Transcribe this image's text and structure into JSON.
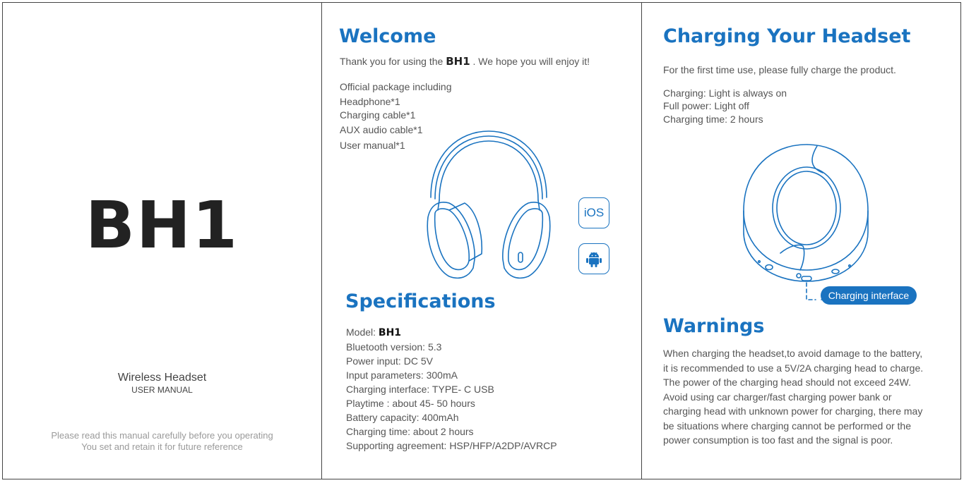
{
  "cover": {
    "title": "BH1",
    "product_name": "Wireless Headset",
    "manual_label": "USER MANUAL",
    "note_lines": [
      "Please read this manual carefully before you operating",
      "You set and retain it for future reference"
    ]
  },
  "welcome": {
    "heading": "Welcome",
    "thanks_before": "Thank you for using the ",
    "thanks_model": "BH1",
    "thanks_after": " . We hope you will enjoy it!",
    "package_lines": [
      "Official package including",
      "Headphone*1",
      "Charging cable*1",
      "AUX audio cable*1",
      "User manual*1"
    ],
    "badges": {
      "ios_label": "iOS",
      "android_icon": "android-icon"
    }
  },
  "specifications": {
    "heading": "Specifications",
    "model_label": "Model: ",
    "model_value": "BH1",
    "lines": [
      "Bluetooth version:  5.3",
      "Power input: DC 5V",
      "Input parameters: 300mA",
      "Charging interface: TYPE- C USB",
      "Playtime : about 45- 50 hours",
      "Battery capacity: 400mAh",
      "Charging time: about 2 hours",
      "Supporting agreement: HSP/HFP/A2DP/AVRCP"
    ]
  },
  "charging": {
    "heading": "Charging Your Headset",
    "intro": "For the first time use, please fully charge the product.",
    "status_lines": [
      "Charging: Light is always on",
      "Full power: Light off",
      "Charging time: 2 hours"
    ],
    "interface_label": "Charging interface"
  },
  "warnings": {
    "heading": "Warnings",
    "lines": [
      "When charging the headset,to avoid damage to the battery,",
      "it is recommended to use a 5V/2A charging head to charge.",
      "The power of the charging head should not exceed 24W.",
      "Avoid using car charger/fast charging power bank or",
      "charging head with unknown power for charging, there may",
      "be situations where charging cannot be performed or the",
      "power consumption is too fast and the signal is poor."
    ]
  },
  "colors": {
    "accent": "#1a73c0",
    "text": "#555555",
    "title": "#222222",
    "note": "#9a9a9a"
  }
}
